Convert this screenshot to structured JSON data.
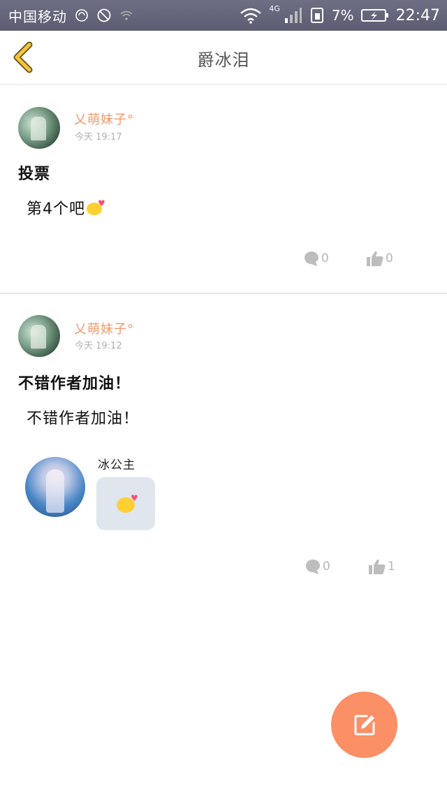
{
  "status_bar": {
    "carrier": "中国移动",
    "network_type": "4G",
    "battery_percent": "7%",
    "time": "22:47"
  },
  "nav": {
    "title": "爵冰泪"
  },
  "posts": [
    {
      "username": "乂萌妹子°",
      "time": "今天 19:17",
      "title": "投票",
      "body": "第4个吧",
      "comment_count": "0",
      "like_count": "0"
    },
    {
      "username": "乂萌妹子°",
      "time": "今天 19:12",
      "title": "不错作者加油！",
      "body": "不错作者加油！",
      "reply": {
        "name": "冰公主"
      },
      "comment_count": "0",
      "like_count": "1"
    }
  ],
  "colors": {
    "accent": "#fb8f65",
    "username": "#f09a6a",
    "status_bar": "#64647a"
  },
  "icons": {
    "back": "chevron-left-icon",
    "comment": "comment-bubble-icon",
    "like": "thumbs-up-icon",
    "compose": "edit-icon"
  }
}
